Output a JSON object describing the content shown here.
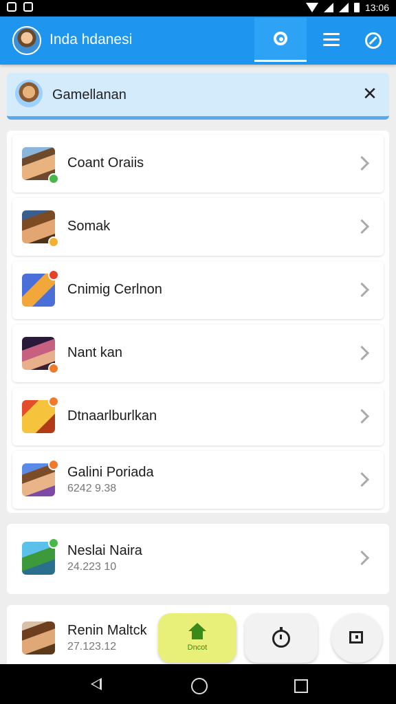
{
  "status_bar": {
    "time": "13:06"
  },
  "app_bar": {
    "title": "Inda hdanesi"
  },
  "search_chip": {
    "query": "Gamellanan"
  },
  "list": [
    {
      "name": "Coant Oraiis",
      "subtitle": ""
    },
    {
      "name": "Somak",
      "subtitle": ""
    },
    {
      "name": "Cnimig Cerlnon",
      "subtitle": ""
    },
    {
      "name": "Nant kan",
      "subtitle": ""
    },
    {
      "name": "Dtnaarlburlkan",
      "subtitle": ""
    },
    {
      "name": "Galini Poriada",
      "subtitle": "6242 9.38"
    },
    {
      "name": "Neslai Naira",
      "subtitle": "24.223 10"
    },
    {
      "name": "Renin Maltck",
      "subtitle": "27.123.12"
    }
  ],
  "bottom_buttons": {
    "home_label": "Dncot"
  },
  "colors": {
    "app_bar": "#1e96f0",
    "search_chip_bg": "#d4ebfc",
    "home_button": "#e9f07a",
    "badge_green": "#49b84a",
    "badge_red": "#e4412b",
    "badge_orange": "#f07a2b"
  },
  "icons": {
    "app_bar": [
      "search-icon",
      "menu-icon",
      "compass-icon"
    ],
    "bottom": [
      "home-icon",
      "timer-icon",
      "square-icon"
    ],
    "nav": [
      "back-icon",
      "home-circle-icon",
      "recents-icon"
    ]
  }
}
